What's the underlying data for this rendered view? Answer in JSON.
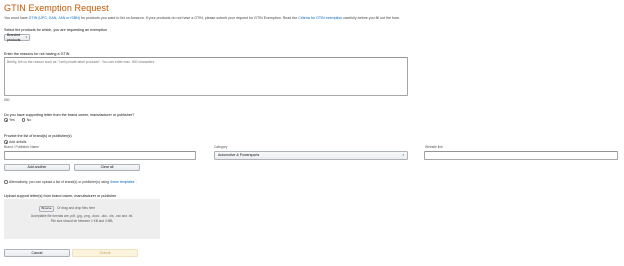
{
  "page": {
    "title": "GTIN Exemption Request",
    "intro_before": "You must have ",
    "intro_link": "GTIN (UPC, EAN, JAN or ISBN)",
    "intro_middle": " for products you want to list on Amazon. If your products do not have a GTIN, please submit your request for GTIN Exemption. Read the ",
    "intro_link2": "Criteria for GTIN exemption",
    "intro_after": " carefully before you fill out the form."
  },
  "products": {
    "label": "Select the products for which, you are requesting an exemption",
    "dropdown_value": "Branded products"
  },
  "reason": {
    "label": "Enter the reasons for not having a GTIN",
    "placeholder": "Briefly, tell us the reason such as \"I sell private label products\". You can enter max. 500 characters",
    "counter": "500"
  },
  "support_letter": {
    "question": "Do you have supporting letter from the brand owner, manufacturer or publisher?",
    "options": [
      "Yes",
      "No"
    ],
    "selected": "Yes"
  },
  "brands": {
    "label": "Provide the list of brand(s) or publisher(s)",
    "add_details": "Add details",
    "brand_name_label": "Brand / Publisher Name",
    "category_label": "Category",
    "category_value": "Automotive & Powersports",
    "website_label": "Website link",
    "add_another": "Add another",
    "clear_all": "Clear all",
    "alternative_before": "Alternatively, you can upload a list of brand(s) or publisher(s) using ",
    "alternative_link": "these templates",
    "alternative_after": "."
  },
  "upload": {
    "label": "Upload support letter(s) from brand owner, manufacturer or publisher",
    "browse": "Browse",
    "drag_text": "Or drag and drop files here",
    "formats": "Acceptable file formats are .pdf, .jpg, .png, .docx, .doc, .xls, .csv and .txt.",
    "size": "File size should be between 1 KB and 4 MB."
  },
  "footer": {
    "cancel": "Cancel",
    "submit": "Submit"
  }
}
